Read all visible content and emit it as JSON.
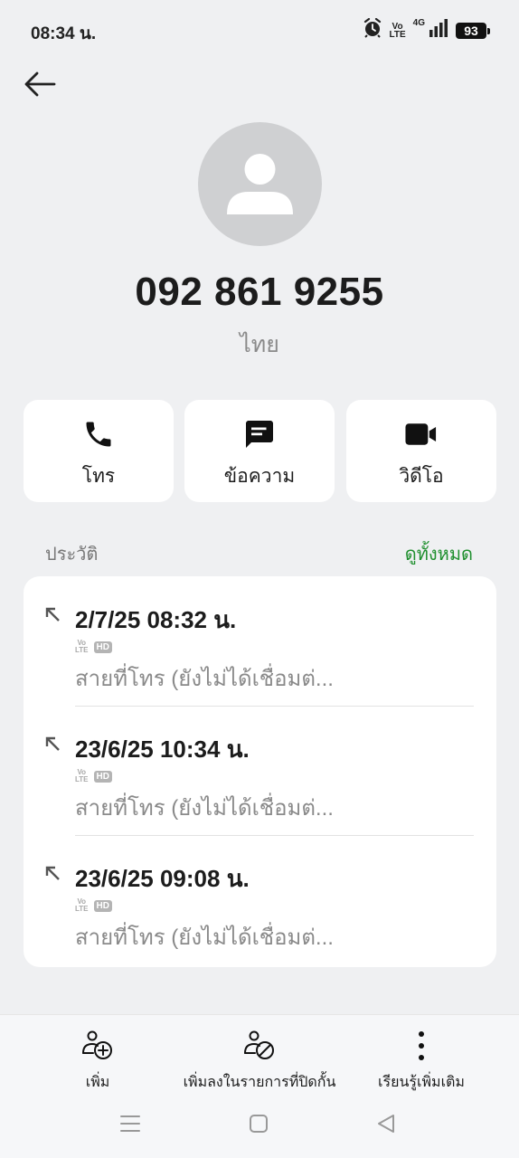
{
  "status_bar": {
    "time": "08:34 น.",
    "volte_top": "Vo",
    "volte_bottom": "LTE",
    "network": "4G",
    "battery": "93"
  },
  "contact": {
    "number": "092 861 9255",
    "country": "ไทย"
  },
  "actions": [
    {
      "label": "โทร",
      "icon": "phone-icon"
    },
    {
      "label": "ข้อความ",
      "icon": "message-icon"
    },
    {
      "label": "วิดีโอ",
      "icon": "video-icon"
    }
  ],
  "history": {
    "title": "ประวัติ",
    "see_all": "ดูทั้งหมด",
    "calls": [
      {
        "datetime": "2/7/25 08:32 น.",
        "volte_top": "Vo",
        "volte_bottom": "LTE",
        "hd": "HD",
        "desc": "สายที่โทร (ยังไม่ได้เชื่อมต่..."
      },
      {
        "datetime": "23/6/25 10:34 น.",
        "volte_top": "Vo",
        "volte_bottom": "LTE",
        "hd": "HD",
        "desc": "สายที่โทร (ยังไม่ได้เชื่อมต่..."
      },
      {
        "datetime": "23/6/25 09:08 น.",
        "volte_top": "Vo",
        "volte_bottom": "LTE",
        "hd": "HD",
        "desc": "สายที่โทร (ยังไม่ได้เชื่อมต่..."
      }
    ]
  },
  "bottom_actions": [
    {
      "label": "เพิ่ม",
      "icon": "add-contact-icon"
    },
    {
      "label": "เพิ่มลงในรายการที่ปิดกั้น",
      "icon": "block-contact-icon"
    },
    {
      "label": "เรียนรู้เพิ่มเติม",
      "icon": "more-vertical-icon"
    }
  ],
  "colors": {
    "background": "#eff0f2",
    "accent_green": "#1f8f2e",
    "card": "#ffffff"
  }
}
